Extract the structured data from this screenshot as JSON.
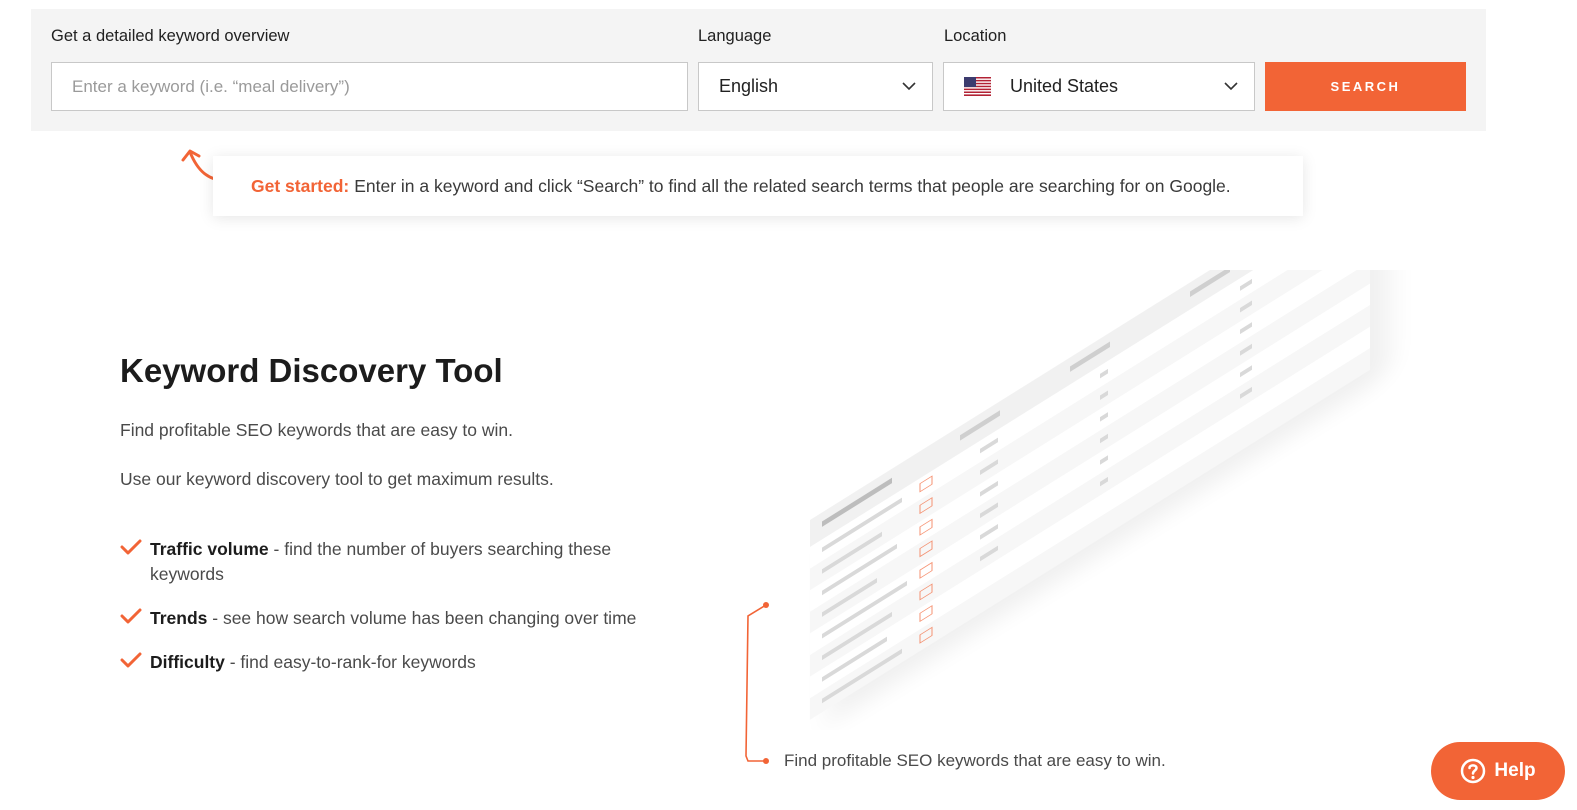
{
  "search": {
    "keyword_label": "Get a detailed keyword overview",
    "keyword_placeholder": "Enter a keyword (i.e. “meal delivery”)",
    "language_label": "Language",
    "language_value": "English",
    "location_label": "Location",
    "location_value": "United States",
    "search_button": "SEARCH"
  },
  "tip": {
    "strong": "Get started:",
    "text": "Enter in a keyword and click “Search” to find all the related search terms that people are searching for on Google."
  },
  "hero": {
    "title": "Keyword Discovery Tool",
    "paragraph1": "Find profitable SEO keywords that are easy to win.",
    "paragraph2": "Use our keyword discovery tool to get maximum results.",
    "features": [
      {
        "title": "Traffic volume",
        "text": " - find the number of buyers searching these keywords"
      },
      {
        "title": "Trends",
        "text": " - see how search volume has been changing over time"
      },
      {
        "title": "Difficulty",
        "text": " - find easy-to-rank-for keywords"
      }
    ]
  },
  "illustration": {
    "caption": "Find profitable SEO keywords that are easy to win."
  },
  "help": {
    "label": "Help"
  },
  "colors": {
    "accent": "#f26436",
    "panel": "#f4f4f4",
    "text": "#212121"
  }
}
